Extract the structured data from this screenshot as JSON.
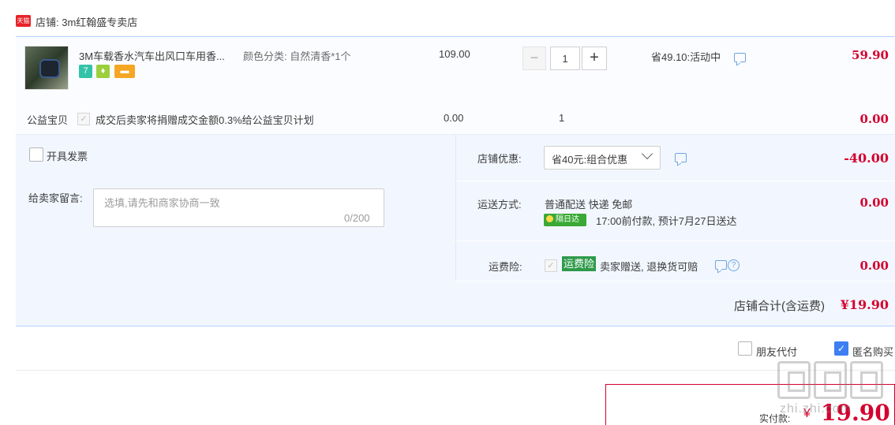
{
  "shop": {
    "logo_text": "天猫",
    "name": "店铺: 3m红翰盛专卖店"
  },
  "item": {
    "title": "3M车载香水汽车出风口车用香...",
    "attr": "颜色分类: 自然清香*1个",
    "badges": [
      {
        "text": "7",
        "color": "#33c3a8"
      },
      {
        "text": "♦",
        "color": "#9bcf3c"
      },
      {
        "text": "▬",
        "color": "#f5a623"
      }
    ],
    "unit_price": "109.00",
    "qty_minus": "−",
    "qty_value": "1",
    "qty_plus": "+",
    "promo": "省49.10:活动中",
    "total": "59.90"
  },
  "charity": {
    "label": "公益宝贝",
    "check": "✓",
    "text": "成交后卖家将捐赠成交金额0.3%给公益宝贝计划",
    "price": "0.00",
    "qty": "1",
    "total": "0.00"
  },
  "invoice": {
    "label": "开具发票"
  },
  "memo": {
    "label": "给卖家留言:",
    "placeholder": "选填,请先和商家协商一致",
    "count": "0/200"
  },
  "shop_discount": {
    "label": "店铺优惠:",
    "selected": "省40元:组合优惠",
    "value": "-40.00"
  },
  "shipping": {
    "label": "运送方式:",
    "method": "普通配送 快递 免邮",
    "sameday_tag": "隔日达",
    "eta": "17:00前付款, 预计7月27日送达",
    "price": "0.00"
  },
  "insurance": {
    "label": "运费险:",
    "check": "✓",
    "tag": "运费险",
    "text": "卖家赠送, 退换货可赔",
    "help": "?",
    "price": "0.00"
  },
  "shop_total": {
    "label": "店铺合计(含运费)",
    "value": "¥19.90"
  },
  "options": {
    "friend_pay": "朋友代付",
    "anonymous": "匿名购买",
    "anonymous_check": "✓"
  },
  "payment": {
    "label": "实付款:",
    "yen": "¥",
    "value": "19.90"
  },
  "watermark": {
    "text": "zhi.zhi.com"
  }
}
